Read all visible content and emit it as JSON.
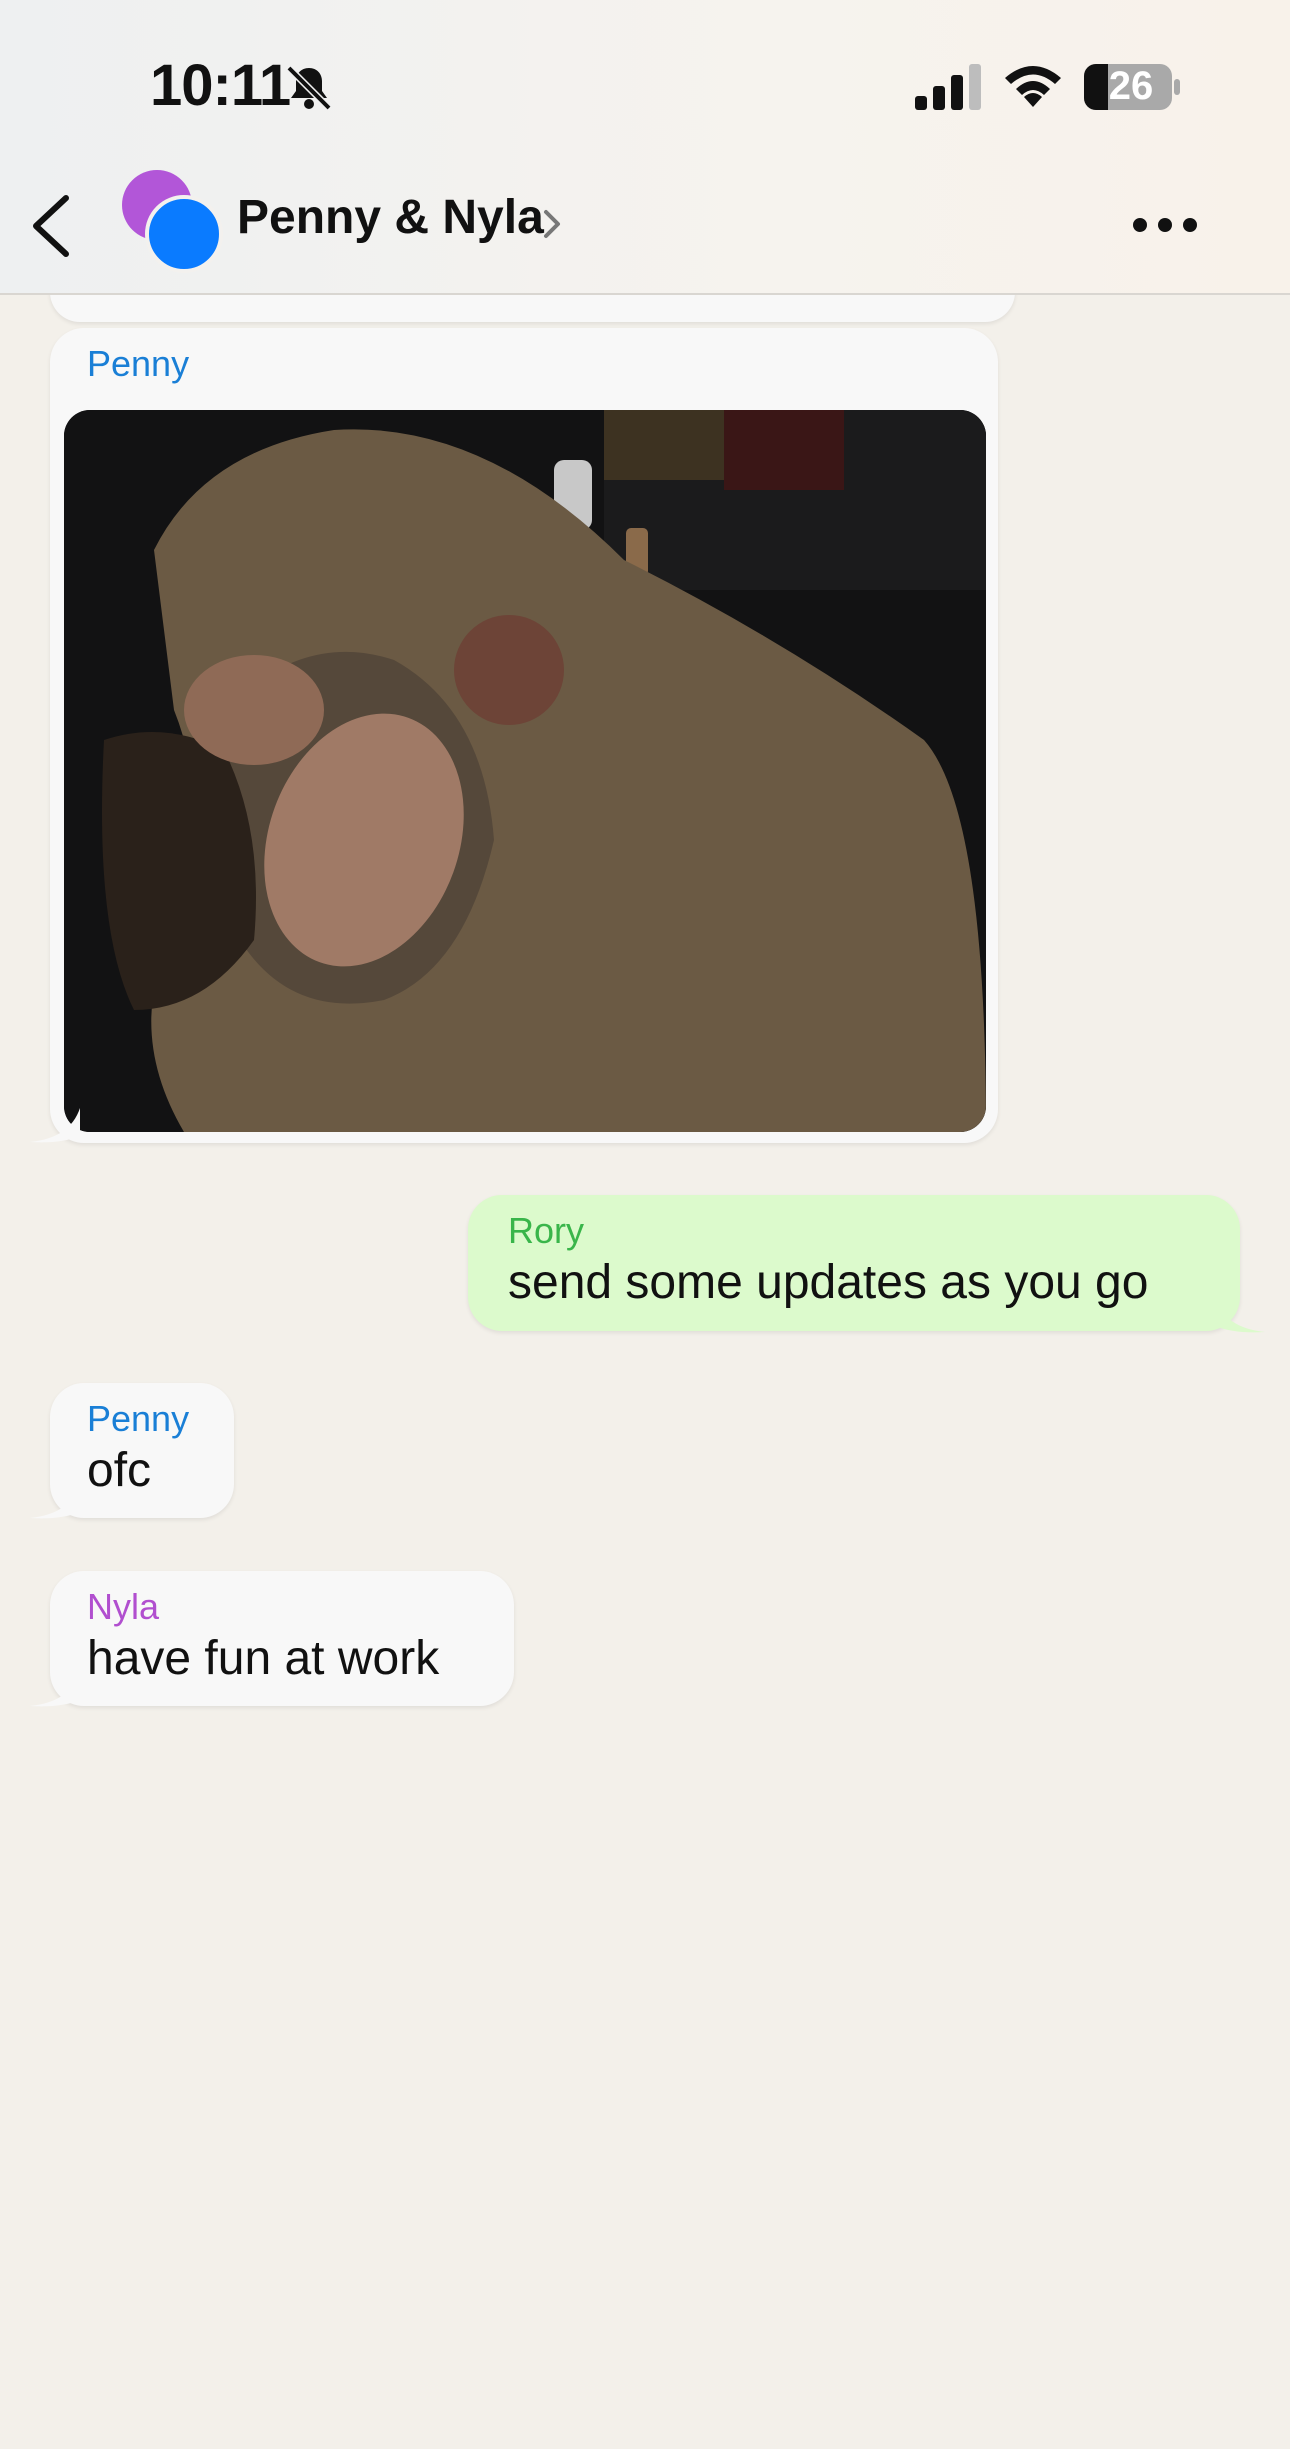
{
  "status_bar": {
    "time": "10:11",
    "battery": "26"
  },
  "header": {
    "title": "Penny & Nyla"
  },
  "messages": [
    {
      "sender": "Penny",
      "type": "image"
    },
    {
      "sender": "Rory",
      "text": "send some updates as you go"
    },
    {
      "sender": "Penny",
      "text": "ofc"
    },
    {
      "sender": "Nyla",
      "text": "have fun at work"
    }
  ],
  "colors": {
    "penny": "#1a7fd6",
    "rory": "#39b54a",
    "nyla": "#b14fcf",
    "outgoing_bubble": "#dcfacc",
    "incoming_bubble": "#f8f8f8"
  },
  "icons": [
    "mute-icon",
    "signal-icon",
    "wifi-icon",
    "battery-icon",
    "back-icon",
    "chevron-right-icon",
    "more-icon"
  ]
}
